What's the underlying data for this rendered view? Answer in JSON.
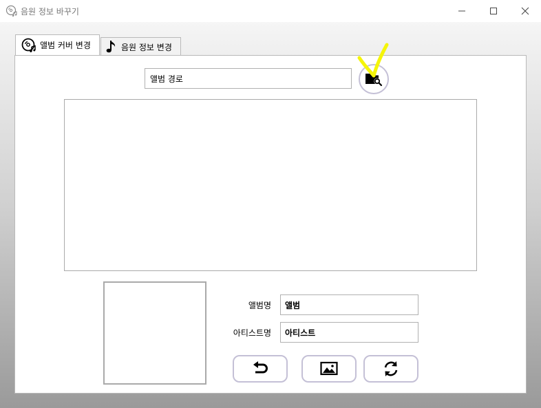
{
  "window": {
    "title": "음원 정보 바꾸기",
    "app_icon": "disc-music-icon"
  },
  "tabs": [
    {
      "label": "앨범 커버 변경",
      "icon": "disc-music-icon",
      "active": true
    },
    {
      "label": "음원 정보 변경",
      "icon": "music-note-icon",
      "active": false
    }
  ],
  "album_cover": {
    "path_input": {
      "value": "앨범 경로"
    },
    "browse_button": {
      "icon": "folder-search-icon"
    },
    "album_field": {
      "label": "앨범명",
      "value": "앨범"
    },
    "artist_field": {
      "label": "아티스트명",
      "value": "아티스트"
    },
    "actions": [
      {
        "name": "undo",
        "icon": "undo-arrow-icon"
      },
      {
        "name": "image",
        "icon": "image-icon"
      },
      {
        "name": "refresh",
        "icon": "refresh-icon"
      }
    ]
  },
  "colors": {
    "button_border": "#c4c0d6",
    "annotation": "#f5f50a"
  }
}
